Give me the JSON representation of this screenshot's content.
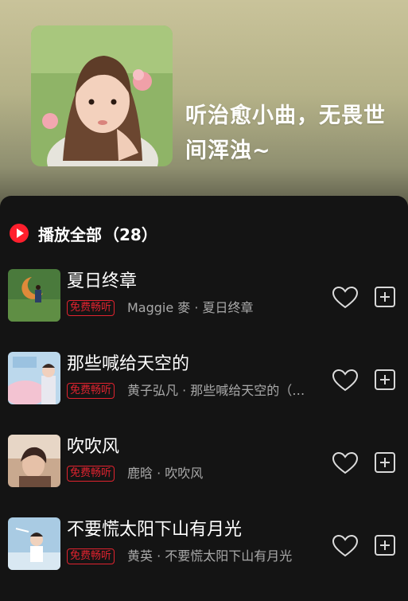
{
  "playlist": {
    "headline": "听治愈小曲，无畏世间浑浊~",
    "cover_icon": "playlist-cover-portrait"
  },
  "play_all": {
    "label": "播放全部",
    "count": "（28）",
    "icon": "play-circle-icon",
    "accent": "#ff1f2d"
  },
  "songs": [
    {
      "title": "夏日终章",
      "badge": "免费畅听",
      "subtitle": "Maggie 麥 · 夏日终章"
    },
    {
      "title": "那些喊给天空的",
      "badge": "免费畅听",
      "subtitle": "黄子弘凡 · 那些喊给天空的（…"
    },
    {
      "title": "吹吹风",
      "badge": "免费畅听",
      "subtitle": "鹿晗 · 吹吹风"
    },
    {
      "title": "不要慌太阳下山有月光",
      "badge": "免费畅听",
      "subtitle": "黄英 · 不要慌太阳下山有月光"
    }
  ],
  "colors": {
    "badge": "#e0232f",
    "background": "#141414"
  }
}
